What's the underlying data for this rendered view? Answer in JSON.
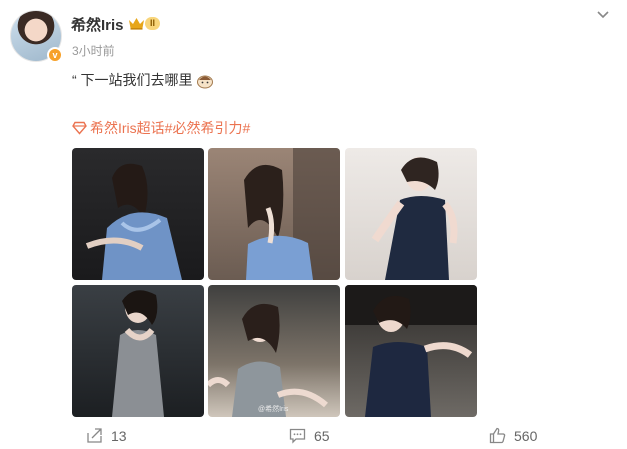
{
  "post": {
    "username": "希然Iris",
    "level_badge": "II",
    "timestamp": "3小时前",
    "text": "“ 下一站我们去哪里",
    "topics": "希然Iris超话#必然希引力#",
    "photo_watermark": "@希然Iris"
  },
  "actions": {
    "repost_count": "13",
    "comment_count": "65",
    "like_count": "560"
  },
  "colors": {
    "topic": "#eb7350",
    "verify": "#f7a12a",
    "crown": "#e7a619"
  },
  "icons": [
    "crown-icon",
    "chevron-down-icon",
    "emoji-icon",
    "diamond-icon",
    "repost-icon",
    "comment-icon",
    "like-icon"
  ]
}
